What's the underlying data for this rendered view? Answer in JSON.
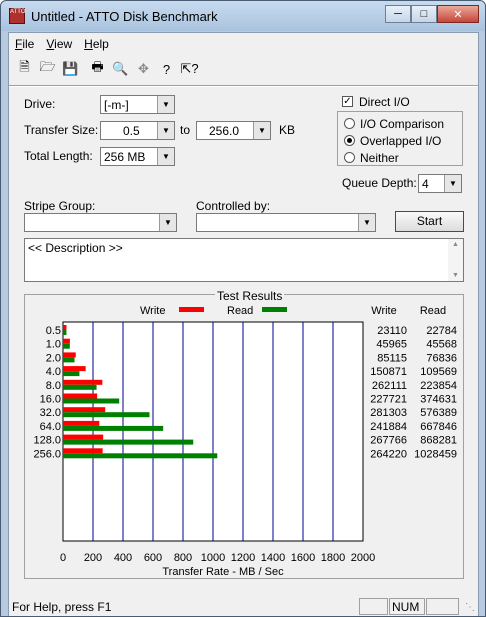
{
  "window": {
    "title": "Untitled - ATTO Disk Benchmark",
    "icon_text": "ATTO"
  },
  "menu": [
    {
      "label": "File",
      "key": "F",
      "rest": "ile"
    },
    {
      "label": "View",
      "key": "V",
      "rest": "iew"
    },
    {
      "label": "Help",
      "key": "H",
      "rest": "elp"
    }
  ],
  "toolbar": [
    "new-icon",
    "open-icon",
    "save-icon",
    "print-icon",
    "print-preview-icon",
    "move-icon",
    "help-icon",
    "context-help-icon"
  ],
  "form": {
    "drive_label": "Drive:",
    "drive_value": "[-m-]",
    "transfer_size_label": "Transfer Size:",
    "transfer_from": "0.5",
    "to_label": "to",
    "transfer_to": "256.0",
    "kb_label": "KB",
    "total_length_label": "Total Length:",
    "total_length_value": "256 MB",
    "direct_io_label": "Direct I/O",
    "io_comparison_label": "I/O Comparison",
    "overlapped_io_label": "Overlapped I/O",
    "neither_label": "Neither",
    "queue_depth_label": "Queue Depth:",
    "queue_depth_value": "4",
    "stripe_group_label": "Stripe Group:",
    "controlled_by_label": "Controlled by:",
    "start_label": "Start",
    "description": "<< Description >>"
  },
  "results": {
    "title": "Test Results",
    "write_label": "Write",
    "read_label": "Read",
    "col_write": "Write",
    "col_read": "Read",
    "xlabel": "Transfer Rate - MB / Sec"
  },
  "colors": {
    "write": "#ff0000",
    "read": "#008000"
  },
  "chart_data": {
    "type": "bar",
    "categories": [
      "0.5",
      "1.0",
      "2.0",
      "4.0",
      "8.0",
      "16.0",
      "32.0",
      "64.0",
      "128.0",
      "256.0"
    ],
    "series": [
      {
        "name": "Write",
        "values": [
          23110,
          45965,
          85115,
          150871,
          262111,
          227721,
          281303,
          241884,
          267766,
          264220
        ]
      },
      {
        "name": "Read",
        "values": [
          22784,
          45568,
          76836,
          109569,
          223854,
          374631,
          576389,
          667846,
          868281,
          1028459
        ]
      }
    ],
    "x_ticks": [
      "0",
      "200",
      "400",
      "600",
      "800",
      "1000",
      "1200",
      "1400",
      "1600",
      "1800",
      "2000"
    ],
    "xlim": [
      0,
      2000
    ],
    "xlabel": "Transfer Rate - MB / Sec",
    "orientation": "horizontal"
  },
  "status": {
    "help_text": "For Help, press F1",
    "num": "NUM"
  }
}
